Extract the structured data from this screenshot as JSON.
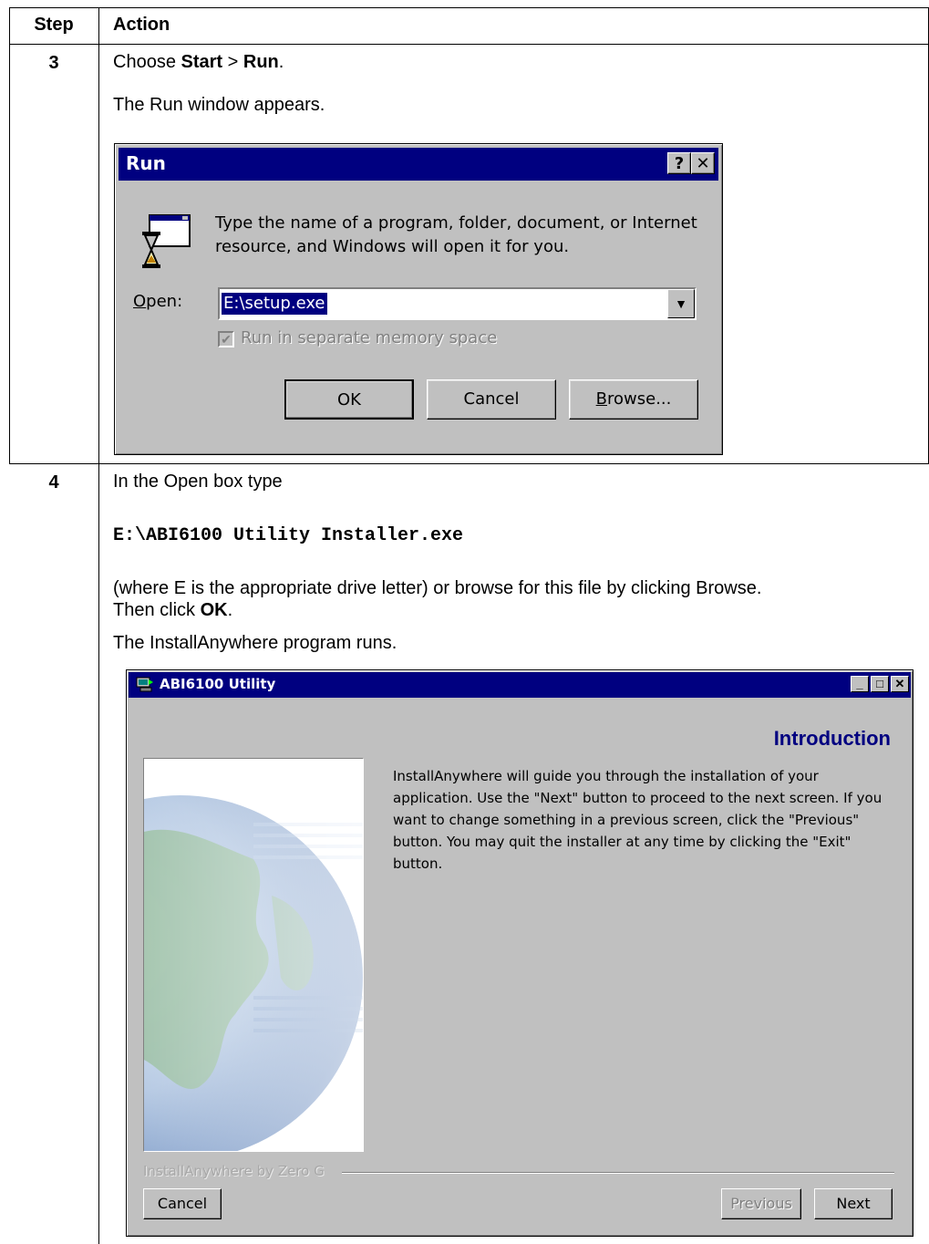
{
  "table": {
    "headers": {
      "step": "Step",
      "action": "Action"
    }
  },
  "step3": {
    "number": "3",
    "instruction_pre": "Choose ",
    "instruction_start": "Start",
    "instruction_sep": " > ",
    "instruction_run": "Run",
    "instruction_post": ".",
    "result": "The Run window appears."
  },
  "run_dialog": {
    "title": "Run",
    "help_glyph": "?",
    "close_glyph": "✕",
    "description_line1": "Type the name of a program, folder, document, or Internet",
    "description_line2": "resource, and Windows will open it for you.",
    "open_label": "Open:",
    "open_value": "E:\\setup.exe",
    "checkbox_label": "Run in separate memory space",
    "checkbox_checked": true,
    "ok_label": "OK",
    "cancel_label": "Cancel",
    "browse_label": "Browse..."
  },
  "step4": {
    "number": "4",
    "instruction": "In the Open box type",
    "command": "E:\\ABI6100 Utility Installer.exe",
    "note_line1": "(where E is the appropriate drive letter) or browse for this file by clicking Browse.",
    "note_line2_pre": "Then click ",
    "note_line2_ok": "OK",
    "note_line2_post": ".",
    "result": "The InstallAnywhere program runs."
  },
  "installer": {
    "title": "ABI6100 Utility",
    "heading": "Introduction",
    "intro_lines": [
      "InstallAnywhere will guide you through the installation of your",
      "application. Use the \"Next\" button to proceed to the next screen. If you",
      "want to change something in a previous screen, click the \"Previous\"",
      "button. You may quit the installer at any time by clicking the \"Exit\"",
      "button."
    ],
    "brand": "InstallAnywhere by Zero G",
    "cancel_label": "Cancel",
    "previous_label": "Previous",
    "next_label": "Next",
    "title_color": "#000080",
    "heading_color": "#000080"
  }
}
